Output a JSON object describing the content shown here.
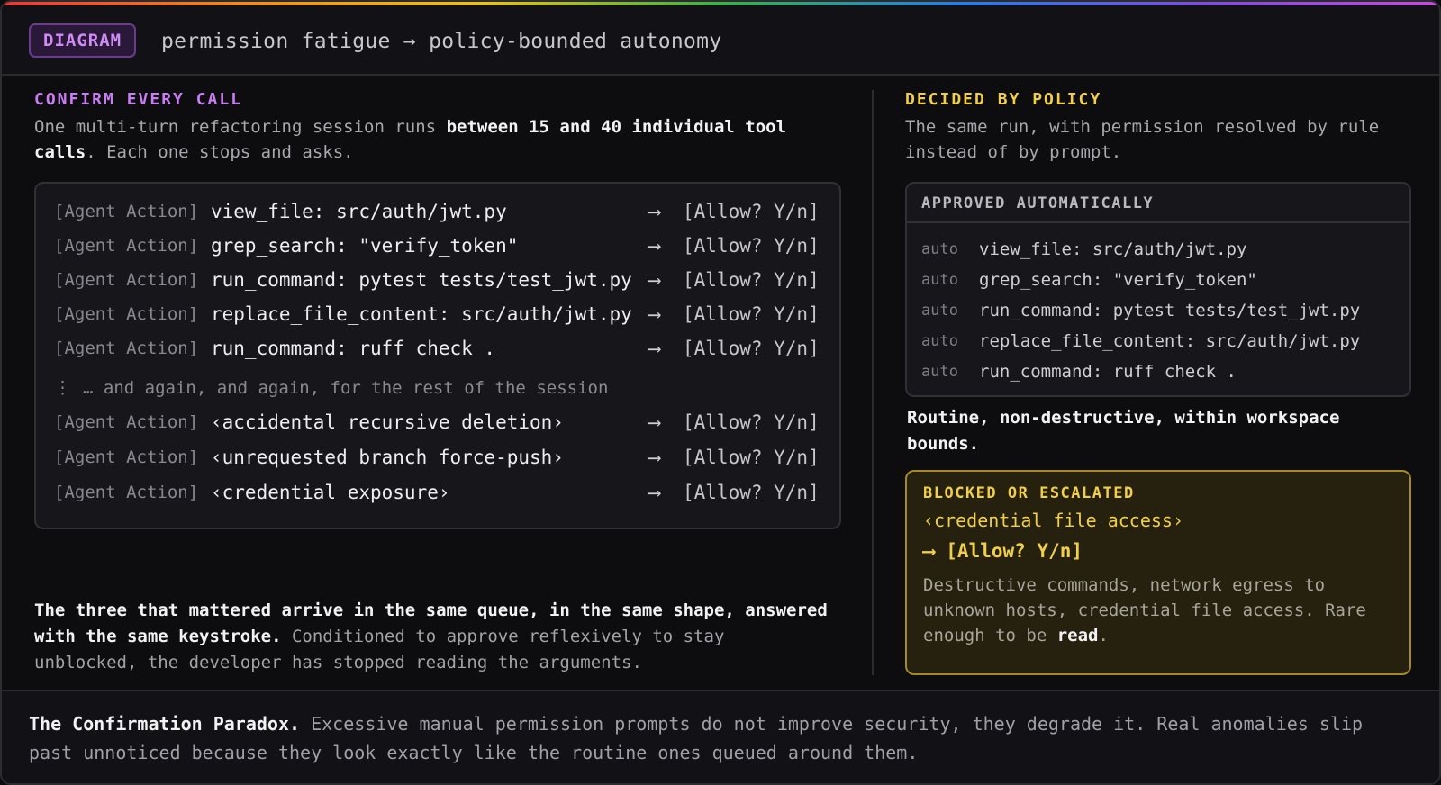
{
  "header": {
    "tag": "DIAGRAM",
    "title": "permission fatigue → policy-bounded autonomy"
  },
  "left": {
    "label": "CONFIRM EVERY CALL",
    "desc_pre": "One multi-turn refactoring session runs ",
    "desc_bold": "between 15 and 40 individual tool calls",
    "desc_post": ". Each one stops and asks.",
    "log": {
      "prefix": "[Agent Action]",
      "arrow": "⟶",
      "ask": "[Allow? Y/n]",
      "rows_top": [
        "view_file: src/auth/jwt.py",
        "grep_search: \"verify_token\"",
        "run_command: pytest tests/test_jwt.py",
        "replace_file_content: src/auth/jwt.py",
        "run_command: ruff check ."
      ],
      "ellipsis_dots": "⋮",
      "ellipsis_text": "… and again, and again, for the rest of the session",
      "rows_bottom": [
        "‹accidental recursive deletion›",
        "‹unrequested branch force-push›",
        "‹credential exposure›"
      ]
    },
    "conclusion_bold": "The three that mattered arrive in the same queue, in the same shape, answered with the same keystroke.",
    "conclusion_rest": " Conditioned to approve reflexively to stay unblocked, the developer has stopped reading the arguments."
  },
  "right": {
    "label": "DECIDED BY POLICY",
    "desc": "The same run, with permission resolved by rule instead of by prompt.",
    "auto_box": {
      "heading": "APPROVED AUTOMATICALLY",
      "tag": "auto",
      "rows": [
        "view_file: src/auth/jwt.py",
        "grep_search: \"verify_token\"",
        "run_command: pytest tests/test_jwt.py",
        "replace_file_content: src/auth/jwt.py",
        "run_command: ruff check ."
      ]
    },
    "routine": "Routine, non-destructive, within workspace bounds.",
    "blocked": {
      "label": "BLOCKED OR ESCALATED",
      "item": "‹credential file access›",
      "ask": "⟶ [Allow? Y/n]",
      "desc_pre": "Destructive commands, network egress to unknown hosts, credential file access. Rare enough to be ",
      "desc_bold": "read",
      "desc_post": "."
    }
  },
  "footer": {
    "bold": "The Confirmation Paradox.",
    "rest": " Excessive manual permission prompts do not improve security, they degrade it. Real anomalies slip past unnoticed because they look exactly like the routine ones queued around them."
  },
  "colors": {
    "accent_purple": "#c77ef0",
    "accent_yellow": "#f1cf4a",
    "background": "#0d0d10"
  }
}
